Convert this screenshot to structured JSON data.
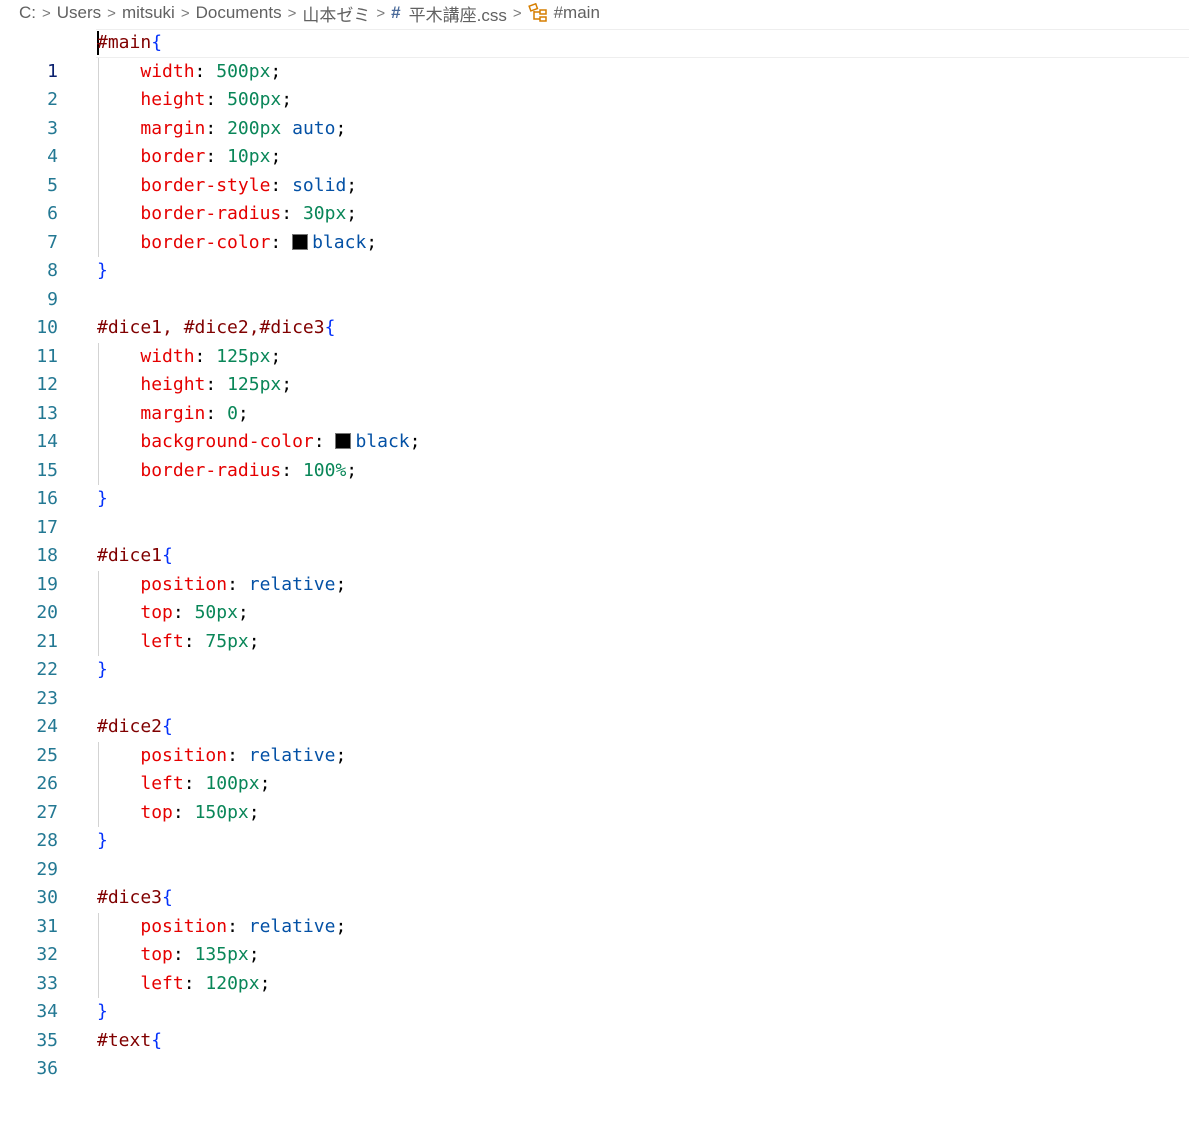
{
  "breadcrumb": {
    "segments": [
      "C:",
      "Users",
      "mitsuki",
      "Documents",
      "山本ゼミ"
    ],
    "file_hash": "#",
    "file": "平木講座.css",
    "symbol": "#main",
    "separator": ">"
  },
  "editor": {
    "current_line": 1,
    "lines": [
      {
        "n": "1"
      },
      {
        "n": "2"
      },
      {
        "n": "3"
      },
      {
        "n": "4"
      },
      {
        "n": "5"
      },
      {
        "n": "6"
      },
      {
        "n": "7"
      },
      {
        "n": "8"
      },
      {
        "n": "9"
      },
      {
        "n": "10"
      },
      {
        "n": "11"
      },
      {
        "n": "12"
      },
      {
        "n": "13"
      },
      {
        "n": "14"
      },
      {
        "n": "15"
      },
      {
        "n": "16"
      },
      {
        "n": "17"
      },
      {
        "n": "18"
      },
      {
        "n": "19"
      },
      {
        "n": "20"
      },
      {
        "n": "21"
      },
      {
        "n": "22"
      },
      {
        "n": "23"
      },
      {
        "n": "24"
      },
      {
        "n": "25"
      },
      {
        "n": "26"
      },
      {
        "n": "27"
      },
      {
        "n": "28"
      },
      {
        "n": "29"
      },
      {
        "n": "30"
      },
      {
        "n": "31"
      },
      {
        "n": "32"
      },
      {
        "n": "33"
      },
      {
        "n": "34"
      },
      {
        "n": "35"
      },
      {
        "n": "36"
      }
    ],
    "code": {
      "l1": {
        "sel": "#main",
        "open": "{"
      },
      "l2": {
        "prop": "width",
        "colon": ": ",
        "val": "500px",
        "semi": ";"
      },
      "l3": {
        "prop": "height",
        "colon": ": ",
        "val": "500px",
        "semi": ";"
      },
      "l4": {
        "prop": "margin",
        "colon": ": ",
        "val": "200px",
        "space": " ",
        "val2": "auto",
        "semi": ";"
      },
      "l5": {
        "prop": "border",
        "colon": ": ",
        "val": "10px",
        "semi": ";"
      },
      "l6": {
        "prop": "border-style",
        "colon": ": ",
        "val": "solid",
        "semi": ";"
      },
      "l7": {
        "prop": "border-radius",
        "colon": ": ",
        "val": "30px",
        "semi": ";"
      },
      "l8": {
        "prop": "border-color",
        "colon": ": ",
        "val": "black",
        "semi": ";",
        "swatch_color": "#000000"
      },
      "l9": {
        "close": "}"
      },
      "l11": {
        "sel": "#dice1, #dice2,#dice3",
        "open": "{"
      },
      "l12": {
        "prop": "width",
        "colon": ": ",
        "val": "125px",
        "semi": ";"
      },
      "l13": {
        "prop": "height",
        "colon": ": ",
        "val": "125px",
        "semi": ";"
      },
      "l14": {
        "prop": "margin",
        "colon": ": ",
        "val": "0",
        "semi": ";"
      },
      "l15": {
        "prop": "background-color",
        "colon": ": ",
        "val": "black",
        "semi": ";",
        "swatch_color": "#000000"
      },
      "l16": {
        "prop": "border-radius",
        "colon": ": ",
        "val": "100%",
        "semi": ";"
      },
      "l17": {
        "close": "}"
      },
      "l19": {
        "sel": "#dice1",
        "open": "{"
      },
      "l20": {
        "prop": "position",
        "colon": ": ",
        "val": "relative",
        "semi": ";"
      },
      "l21": {
        "prop": "top",
        "colon": ": ",
        "val": "50px",
        "semi": ";"
      },
      "l22": {
        "prop": "left",
        "colon": ": ",
        "val": "75px",
        "semi": ";"
      },
      "l23": {
        "close": "}"
      },
      "l25": {
        "sel": "#dice2",
        "open": "{"
      },
      "l26": {
        "prop": "position",
        "colon": ": ",
        "val": "relative",
        "semi": ";"
      },
      "l27": {
        "prop": "left",
        "colon": ": ",
        "val": "100px",
        "semi": ";"
      },
      "l28": {
        "prop": "top",
        "colon": ": ",
        "val": "150px",
        "semi": ";"
      },
      "l29": {
        "close": "}"
      },
      "l31": {
        "sel": "#dice3",
        "open": "{"
      },
      "l32": {
        "prop": "position",
        "colon": ": ",
        "val": "relative",
        "semi": ";"
      },
      "l33": {
        "prop": "top",
        "colon": ": ",
        "val": "135px",
        "semi": ";"
      },
      "l34": {
        "prop": "left",
        "colon": ": ",
        "val": "120px",
        "semi": ";"
      },
      "l35": {
        "close": "}"
      },
      "l36": {
        "sel": "#text",
        "open": "{"
      }
    }
  },
  "colors": {
    "selector": "#800000",
    "property": "#e50000",
    "number": "#098658",
    "keyword": "#0451a5",
    "brace": "#0431fa",
    "line_number": "#237893",
    "line_number_active": "#0b216f"
  }
}
